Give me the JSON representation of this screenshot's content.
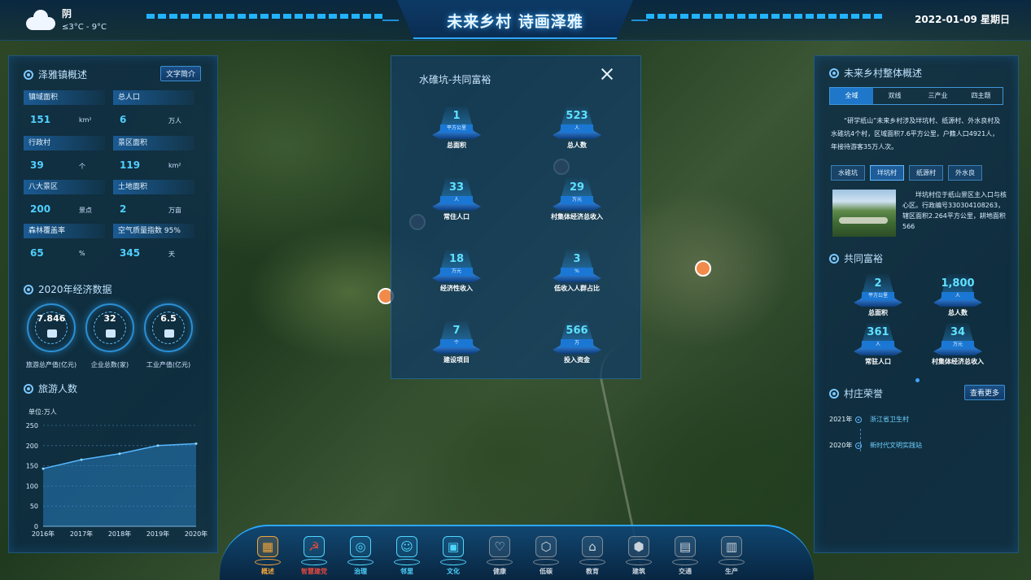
{
  "header": {
    "title": "未来乡村 诗画泽雅",
    "weather": {
      "label": "阴",
      "temp": "≤3°C - 9°C",
      "icon": "cloud-icon"
    },
    "date": "2022-01-09 星期日"
  },
  "left": {
    "overview": {
      "title": "泽雅镇概述",
      "button": "文字简介",
      "stats": [
        {
          "label": "镇域面积",
          "value": "151",
          "unit": "km²"
        },
        {
          "label": "总人口",
          "value": "6",
          "unit": "万人"
        },
        {
          "label": "行政村",
          "value": "39",
          "unit": "个"
        },
        {
          "label": "景区面积",
          "value": "119",
          "unit": "km²"
        },
        {
          "label": "八大景区",
          "value": "200",
          "unit": "景点"
        },
        {
          "label": "土地面积",
          "value": "2",
          "unit": "万亩"
        },
        {
          "label": "森林覆盖率",
          "value": "65",
          "unit": "%"
        },
        {
          "label": "空气质量指数 95%",
          "value": "345",
          "unit": "天"
        }
      ]
    },
    "economy": {
      "title": "2020年经济数据",
      "rings": [
        {
          "value": "7.846",
          "label": "旅游总产值(亿元)",
          "icon": "money-icon"
        },
        {
          "value": "32",
          "label": "企业总数(家)",
          "icon": "building-icon"
        },
        {
          "value": "6.5",
          "label": "工业产值(亿元)",
          "icon": "factory-icon"
        }
      ]
    },
    "tourism": {
      "title": "旅游人数",
      "chart_data": {
        "type": "area",
        "title": "",
        "ylabel": "单位:万人",
        "xlabel": "",
        "categories": [
          "2016年",
          "2017年",
          "2018年",
          "2019年",
          "2020年"
        ],
        "values": [
          143,
          165,
          180,
          200,
          205
        ],
        "ylim": [
          0,
          250
        ],
        "yticks": [
          "0",
          "50",
          "100",
          "150",
          "200",
          "250"
        ],
        "grid": true,
        "color": "#2c8fd6"
      }
    }
  },
  "popup": {
    "title": "水碓坑-共同富裕",
    "metrics": [
      {
        "value": "1",
        "unit": "平方公里",
        "label": "总面积"
      },
      {
        "value": "523",
        "unit": "人",
        "label": "总人数"
      },
      {
        "value": "33",
        "unit": "人",
        "label": "常住人口"
      },
      {
        "value": "29",
        "unit": "万元",
        "label": "村集体经济总收入"
      },
      {
        "value": "18",
        "unit": "万元",
        "label": "经济性收入"
      },
      {
        "value": "3",
        "unit": "%",
        "label": "低收入人群占比"
      },
      {
        "value": "7",
        "unit": "个",
        "label": "建设项目"
      },
      {
        "value": "566",
        "unit": "万",
        "label": "投入资金"
      }
    ]
  },
  "right": {
    "overview_title": "未来乡村整体概述",
    "tabs": [
      "全域",
      "双线",
      "三产业",
      "四主题"
    ],
    "active_tab": 0,
    "description": "“研学纸山”未来乡村涉及垟坑村、纸源村、外水良村及水碓坑4个村，区域面积7.6平方公里，户籍人口4921人，年接待游客35万人次。",
    "villages": [
      "水碓坑",
      "垟坑村",
      "纸源村",
      "外水良"
    ],
    "active_village": 1,
    "village_text": "垟坑村位于纸山景区主入口与核心区。行政编号330304108263，辖区面积2.264平方公里，耕地面积566",
    "wealth_title": "共同富裕",
    "wealth_metrics": [
      {
        "value": "2",
        "unit": "平方公里",
        "label": "总面积"
      },
      {
        "value": "1,800",
        "unit": "人",
        "label": "总人数"
      },
      {
        "value": "361",
        "unit": "人",
        "label": "常驻人口"
      },
      {
        "value": "34",
        "unit": "万元",
        "label": "村集体经济总收入"
      }
    ],
    "honor_title": "村庄荣誉",
    "honor_button": "查看更多",
    "honors": [
      {
        "year": "2021年",
        "text": "浙江省卫生村"
      },
      {
        "year": "2020年",
        "text": "新时代文明实践站"
      }
    ]
  },
  "nav": {
    "active": 0,
    "items": [
      {
        "label": "概述",
        "icon": "grid-icon",
        "color": "#f0a43a"
      },
      {
        "label": "智慧建党",
        "icon": "party-icon",
        "color": "#e8493f"
      },
      {
        "label": "治理",
        "icon": "governance-icon",
        "color": "#4fd6ff"
      },
      {
        "label": "邻里",
        "icon": "neighbor-icon",
        "color": "#4fd6ff"
      },
      {
        "label": "文化",
        "icon": "culture-icon",
        "color": "#4fd6ff"
      },
      {
        "label": "健康",
        "icon": "health-icon",
        "color": "#c9d3dc"
      },
      {
        "label": "低碳",
        "icon": "lowcarbon-icon",
        "color": "#c9d3dc"
      },
      {
        "label": "教育",
        "icon": "education-icon",
        "color": "#c9d3dc"
      },
      {
        "label": "建筑",
        "icon": "building-icon",
        "color": "#c9d3dc"
      },
      {
        "label": "交通",
        "icon": "bus-icon",
        "color": "#c9d3dc"
      },
      {
        "label": "生产",
        "icon": "production-icon",
        "color": "#c9d3dc"
      }
    ]
  }
}
